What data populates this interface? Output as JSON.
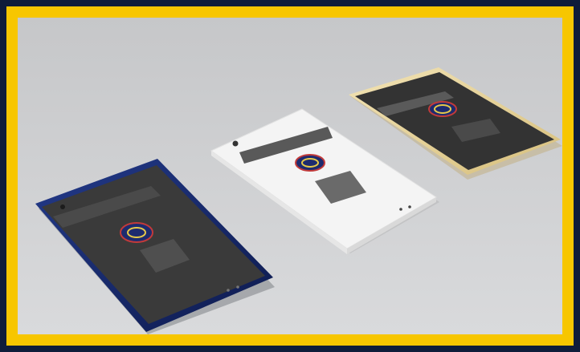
{
  "scene": {
    "frame_color": "#0f1c3a",
    "border_color": "#f7c600",
    "background_color": "#cfd0d2",
    "devices": [
      {
        "name": "navy-tablet",
        "body_color": "#1b2a6b",
        "screen_color": "#3a3a3a",
        "logo": "flower-logo-icon"
      },
      {
        "name": "white-tablet",
        "body_color": "#f4f4f4",
        "screen_color": "#ffffff",
        "logo": "flower-logo-icon"
      },
      {
        "name": "gold-tablet",
        "body_color": "#e8d6a3",
        "screen_color": "#333333",
        "logo": "flower-logo-icon"
      }
    ]
  }
}
